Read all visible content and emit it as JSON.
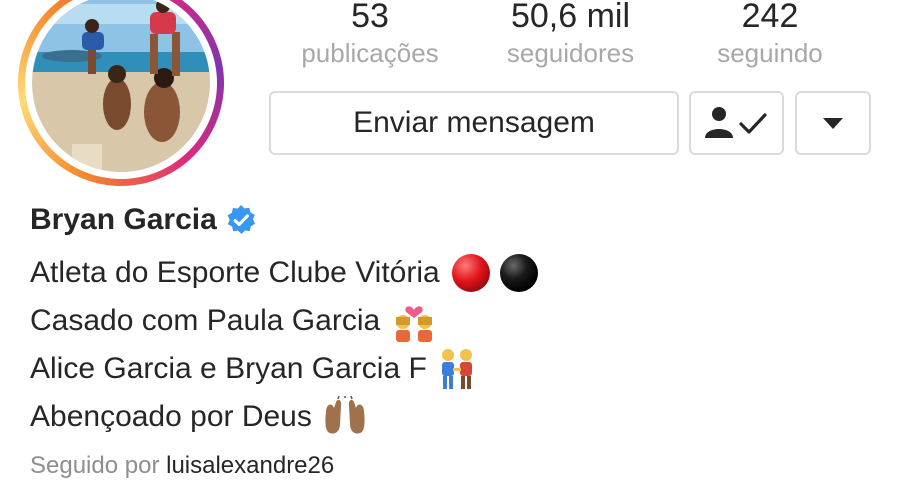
{
  "profile": {
    "name": "Bryan Garcia",
    "verified_icon": "verified-badge-icon",
    "colors": {
      "verified": "#3897f0",
      "muted": "#8e8e8e",
      "stat_label": "#a8a8a8",
      "border": "#dbdbdb"
    }
  },
  "stats": {
    "posts": {
      "value": "53",
      "label": "publicações"
    },
    "followers": {
      "value": "50,6 mil",
      "label": "seguidores"
    },
    "following": {
      "value": "242",
      "label": "seguindo"
    }
  },
  "actions": {
    "message_label": "Enviar mensagem",
    "following_icon": "person-check-icon",
    "dropdown_icon": "caret-down-icon"
  },
  "bio": {
    "line1": "Atleta do Esporte Clube Vitória",
    "line2": "Casado com Paula Garcia",
    "line3": "Alice Garcia e Bryan Garcia F",
    "line4": "Abençoado por Deus",
    "line1_icons": [
      "red-circle-icon",
      "black-circle-icon"
    ],
    "line2_icon": "couple-with-heart-icon",
    "line3_icon": "man-and-woman-holding-hands-icon",
    "line4_icon": "raising-hands-icon"
  },
  "followed_by": {
    "prefix": "Seguido por",
    "user": "luisalexandre26"
  }
}
